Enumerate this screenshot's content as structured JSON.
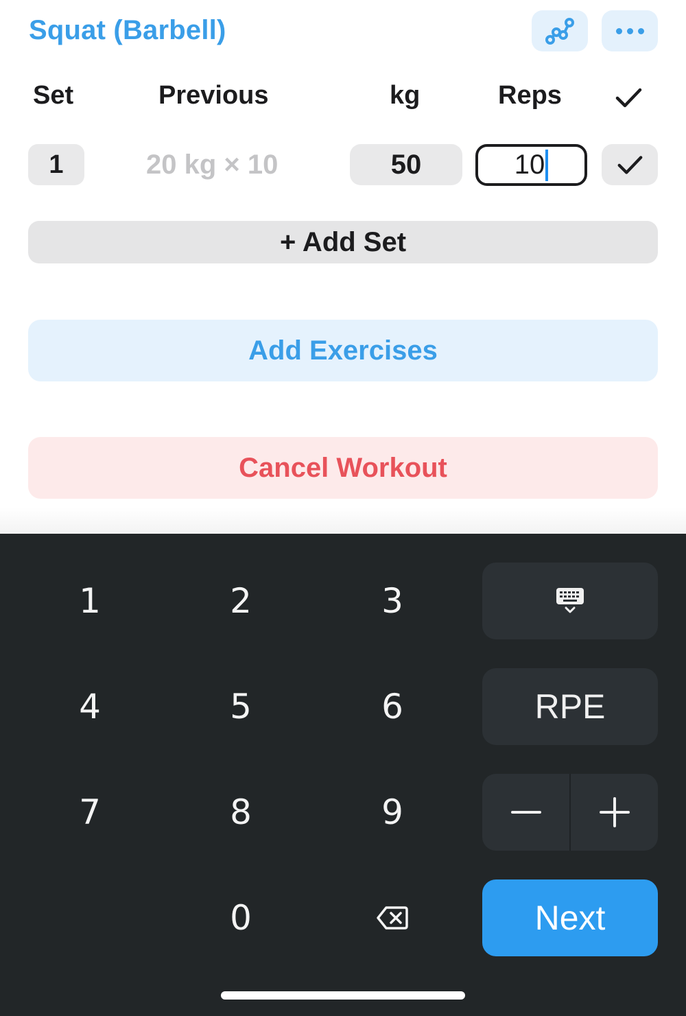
{
  "exercise": {
    "title": "Squat (Barbell)",
    "accent_color": "#3a9ee8",
    "actions": [
      {
        "icon": "graph-chart-icon"
      },
      {
        "icon": "more-dots-icon"
      }
    ]
  },
  "table": {
    "columns": [
      "Set",
      "Previous",
      "kg",
      "Reps"
    ],
    "check_icon": "checkmark-icon",
    "rows": [
      {
        "set": "1",
        "previous": "20 kg × 10",
        "kg": "50",
        "reps": "10",
        "done_icon": "checkmark-icon"
      }
    ]
  },
  "buttons": {
    "add_set": "+ Add Set",
    "add_exercises": "Add Exercises",
    "cancel_workout": "Cancel Workout"
  },
  "keypad": {
    "digits": [
      "1",
      "2",
      "3",
      "4",
      "5",
      "6",
      "7",
      "8",
      "9",
      "0"
    ],
    "hide_keyboard_icon": "keyboard-dismiss-icon",
    "rpe": "RPE",
    "minus_icon": "minus-icon",
    "plus_icon": "plus-icon",
    "backspace_icon": "backspace-icon",
    "next": "Next",
    "next_color": "#2d9cf0"
  }
}
